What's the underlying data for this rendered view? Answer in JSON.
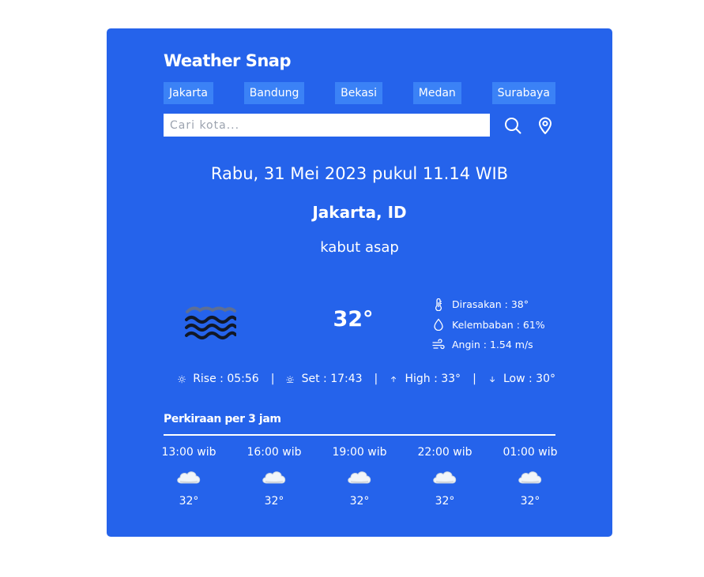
{
  "app": {
    "title": "Weather Snap"
  },
  "cities": [
    "Jakarta",
    "Bandung",
    "Bekasi",
    "Medan",
    "Surabaya"
  ],
  "search": {
    "placeholder": "Cari kota...",
    "value": ""
  },
  "current": {
    "datetime": "Rabu, 31 Mei 2023 pukul 11.14 WIB",
    "location": "Jakarta, ID",
    "description": "kabut asap",
    "icon": "mist-icon",
    "temperature": "32°",
    "details": {
      "feels_like": "Dirasakan : 38°",
      "humidity": "Kelembaban : 61%",
      "wind": "Angin : 1.54 m/s"
    },
    "sun": {
      "rise": "Rise : 05:56",
      "set": "Set : 17:43",
      "high": "High : 33°",
      "low": "Low : 30°",
      "separator": "|"
    }
  },
  "forecast": {
    "title": "Perkiraan per 3 jam",
    "items": [
      {
        "time": "13:00 wib",
        "icon": "cloud-icon",
        "temp": "32°"
      },
      {
        "time": "16:00 wib",
        "icon": "cloud-icon",
        "temp": "32°"
      },
      {
        "time": "19:00 wib",
        "icon": "cloud-icon",
        "temp": "32°"
      },
      {
        "time": "22:00 wib",
        "icon": "cloud-icon",
        "temp": "32°"
      },
      {
        "time": "01:00 wib",
        "icon": "cloud-icon",
        "temp": "32°"
      }
    ]
  },
  "colors": {
    "card": "#2563eb",
    "city_button": "#3b82f6",
    "text": "#ffffff"
  }
}
